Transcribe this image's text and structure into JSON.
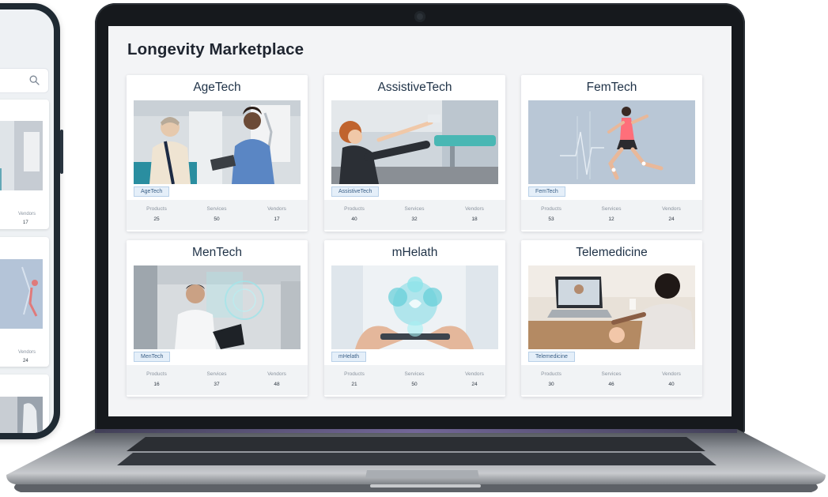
{
  "app": {
    "title": "Longevity Marketplace"
  },
  "phone": {
    "cards": [
      {
        "stat_label": "Vendors",
        "stat_value": "17"
      },
      {
        "stat_label": "Vendors",
        "stat_value": "24"
      }
    ]
  },
  "cards": [
    {
      "title": "AgeTech",
      "tag": "AgeTech",
      "image": "agetech-photo",
      "stats": [
        {
          "label": "Products",
          "value": "25"
        },
        {
          "label": "Services",
          "value": "50"
        },
        {
          "label": "Vendors",
          "value": "17"
        }
      ]
    },
    {
      "title": "AssistiveTech",
      "tag": "AssistiveTech",
      "image": "assistivetech-photo",
      "stats": [
        {
          "label": "Products",
          "value": "40"
        },
        {
          "label": "Services",
          "value": "32"
        },
        {
          "label": "Vendors",
          "value": "18"
        }
      ]
    },
    {
      "title": "FemTech",
      "tag": "FemTech",
      "image": "femtech-photo",
      "stats": [
        {
          "label": "Products",
          "value": "53"
        },
        {
          "label": "Services",
          "value": "12"
        },
        {
          "label": "Vendors",
          "value": "24"
        }
      ]
    },
    {
      "title": "MenTech",
      "tag": "MenTech",
      "image": "mentech-photo",
      "stats": [
        {
          "label": "Products",
          "value": "16"
        },
        {
          "label": "Services",
          "value": "37"
        },
        {
          "label": "Vendors",
          "value": "48"
        }
      ]
    },
    {
      "title": "mHelath",
      "tag": "mHelath",
      "image": "mhealth-photo",
      "stats": [
        {
          "label": "Products",
          "value": "21"
        },
        {
          "label": "Services",
          "value": "50"
        },
        {
          "label": "Vendors",
          "value": "24"
        }
      ]
    },
    {
      "title": "Telemedicine",
      "tag": "Telemedicine",
      "image": "telemedicine-photo",
      "stats": [
        {
          "label": "Products",
          "value": "30"
        },
        {
          "label": "Services",
          "value": "46"
        },
        {
          "label": "Vendors",
          "value": "40"
        }
      ]
    }
  ],
  "icons": {
    "search": "search-icon",
    "camera": "camera-icon"
  },
  "colors": {
    "title": "#1f2530",
    "card_title": "#1f3247",
    "tag_bg": "#e5eff9",
    "tag_border": "#b8d0e8",
    "tag_text": "#3a5f86",
    "stats_bg": "#f1f3f5",
    "laptop_bezel": "#16191d",
    "phone_body": "#1f2a33"
  }
}
